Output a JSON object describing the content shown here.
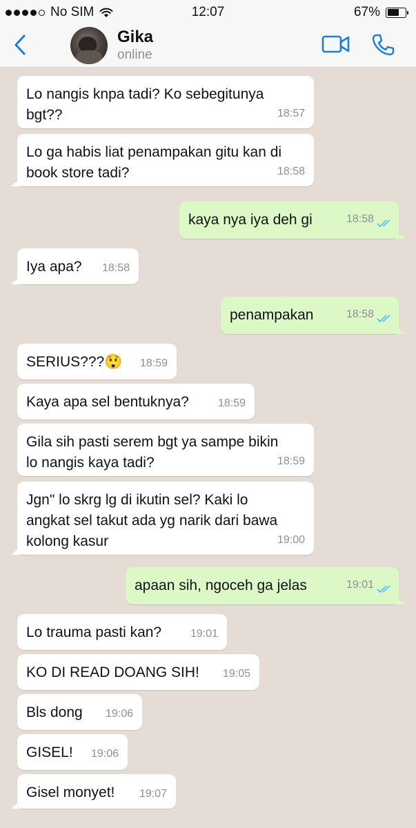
{
  "status_bar": {
    "carrier": "No SIM",
    "time": "12:07",
    "battery_percent": "67%",
    "battery_level": 0.67
  },
  "header": {
    "back_icon": "chevron-left-icon",
    "contact_name": "Gika",
    "contact_status": "online",
    "video_icon": "video-camera-icon",
    "call_icon": "phone-icon",
    "accent_color": "#1a7fd4"
  },
  "colors": {
    "chat_background": "#e5ddd5",
    "incoming_bubble": "#ffffff",
    "outgoing_bubble": "#dcf8c6",
    "read_ticks": "#4fc3f7"
  },
  "messages": [
    {
      "dir": "in",
      "text": "Lo nangis knpa tadi? Ko sebegitunya\nbgt??",
      "time": "18:57"
    },
    {
      "dir": "in",
      "text": "Lo ga habis liat penampakan gitu kan di\nbook store tadi?",
      "time": "18:58"
    },
    {
      "dir": "out",
      "text": "kaya nya iya deh gi",
      "time": "18:58",
      "status": "read"
    },
    {
      "dir": "in",
      "text": "Iya apa?",
      "time": "18:58"
    },
    {
      "dir": "out",
      "text": "penampakan",
      "time": "18:58",
      "status": "read"
    },
    {
      "dir": "in",
      "text": "SERIUS???😲",
      "time": "18:59"
    },
    {
      "dir": "in",
      "text": "Kaya apa sel bentuknya?",
      "time": "18:59"
    },
    {
      "dir": "in",
      "text": "Gila sih pasti serem bgt ya sampe bikin\nlo nangis kaya tadi?",
      "time": "18:59"
    },
    {
      "dir": "in",
      "text": "Jgn\" lo skrg lg di ikutin sel? Kaki lo\nangkat sel takut ada yg narik dari bawa\nkolong kasur",
      "time": "19:00"
    },
    {
      "dir": "out",
      "text": "apaan sih, ngoceh ga jelas",
      "time": "19:01",
      "status": "read"
    },
    {
      "dir": "in",
      "text": "Lo trauma pasti kan?",
      "time": "19:01"
    },
    {
      "dir": "in",
      "text": "KO DI READ DOANG SIH!",
      "time": "19:05"
    },
    {
      "dir": "in",
      "text": "Bls dong",
      "time": "19:06"
    },
    {
      "dir": "in",
      "text": "GISEL!",
      "time": "19:06"
    },
    {
      "dir": "in",
      "text": "Gisel monyet!",
      "time": "19:07"
    }
  ]
}
